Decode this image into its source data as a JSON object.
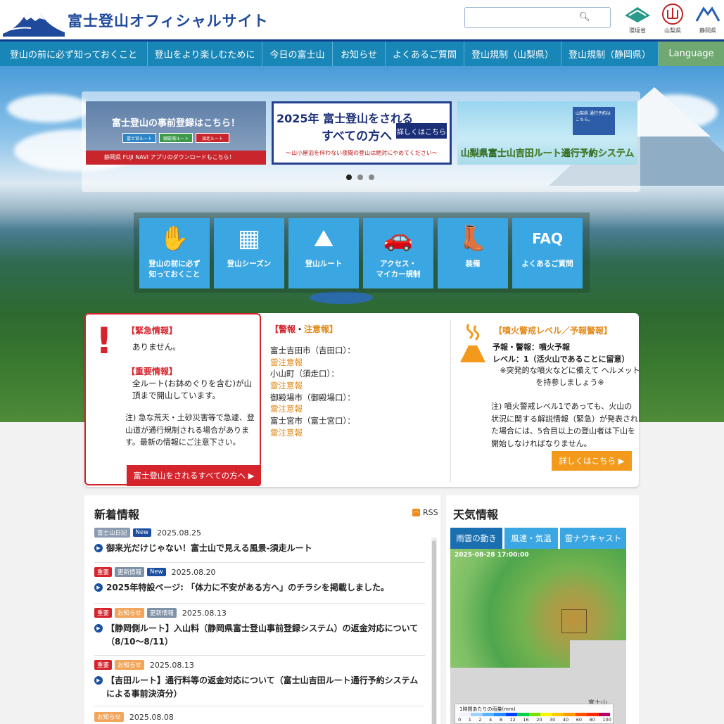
{
  "header": {
    "site_title": "富士登山オフィシャルサイト",
    "search_placeholder": "",
    "gov_logos": [
      {
        "name": "環境省",
        "icon": "env-ministry-logo"
      },
      {
        "name": "山梨県",
        "icon": "yamanashi-logo"
      },
      {
        "name": "静岡県",
        "icon": "shizuoka-logo"
      }
    ]
  },
  "nav": {
    "items": [
      {
        "label": "登山の前に必ず知っておくこと"
      },
      {
        "label": "登山をより楽しむために"
      },
      {
        "label": "今日の富士山"
      },
      {
        "label": "お知らせ"
      },
      {
        "label": "よくあるご質問"
      },
      {
        "label": "登山規制（山梨県）"
      },
      {
        "label": "登山規制（静岡県）"
      }
    ],
    "language": "Language"
  },
  "banners": {
    "b1": {
      "title": "富士登山の事前登録はこちら！",
      "routes": [
        "富士宮ルート",
        "御殿場ルート",
        "須走ルート"
      ],
      "footer": "静岡県 FUJI NAVI アプリのダウンロードもこちら！"
    },
    "b2": {
      "line1": "2025年 富士登山をされる",
      "line2": "すべての方へ",
      "button": "詳しくはこちら",
      "note": "～山小屋泊を伴わない夜間の登山は絶対にやめてください～"
    },
    "b3": {
      "box": "山梨県 通行予約はこちら。",
      "title": "山梨県富士山吉田ルート通行予約システム"
    }
  },
  "tiles": [
    {
      "label": "登山の前に必ず\n知っておくこと",
      "icon": "hand-icon",
      "glyph": "✋"
    },
    {
      "label": "登山シーズン",
      "icon": "calendar-icon",
      "glyph": "▦"
    },
    {
      "label": "登山ルート",
      "icon": "hiker-icon",
      "glyph": "⛰"
    },
    {
      "label": "アクセス・\nマイカー規制",
      "icon": "car-icon",
      "glyph": "🚗"
    },
    {
      "label": "装備",
      "icon": "hat-boot-icon",
      "glyph": "👢"
    },
    {
      "label": "よくあるご質問",
      "icon": "faq-icon",
      "glyph": "FAQ"
    }
  ],
  "emergency": {
    "heading1": "【緊急情報】",
    "text1": "ありません。",
    "heading2": "【重要情報】",
    "text2": "全ルート(お鉢めぐりを含む)が山頂まで開山しています。",
    "note": "注) 急な荒天・土砂災害等で急遽、登山道が通行規制される場合があります。最新の情報にご注意下さい。",
    "button": "富士登山をされるすべての方へ ▶"
  },
  "warnings": {
    "heading_a": "【警報",
    "sep": "・",
    "heading_b": "注意報】",
    "items": [
      {
        "place": "富士吉田市（吉田口）：",
        "level": "雷注意報"
      },
      {
        "place": "小山町（須走口）：",
        "level": "雷注意報"
      },
      {
        "place": "御殿場市（御殿場口）：",
        "level": "雷注意報"
      },
      {
        "place": "富士宮市（富士宮口）：",
        "level": "雷注意報"
      }
    ]
  },
  "volcano": {
    "heading": "【噴火警戒レベル／予報警報】",
    "line1": "予報・警報：噴火予報",
    "line2": "レベル：1（活火山であることに留意）",
    "line3": "※突発的な噴火などに備えて ヘルメットを持参しましょう※",
    "note": "注) 噴火警戒レベル1であっても、火山の状況に関する解説情報（緊急）が発表された場合には、5合目以上の登山者は下山を開始しなければなりません。",
    "button": "詳しくはこちら ▶"
  },
  "news": {
    "title": "新着情報",
    "rss": "RSS",
    "items": [
      {
        "tags": [
          {
            "text": "富士山日記",
            "color": "gray"
          },
          {
            "text": "New",
            "color": "blue"
          }
        ],
        "date": "2025.08.25",
        "headline": "御来光だけじゃない！富士山で見える風景-須走ルート"
      },
      {
        "tags": [
          {
            "text": "重要",
            "color": "red"
          },
          {
            "text": "更新情報",
            "color": "slate"
          },
          {
            "text": "New",
            "color": "blue"
          }
        ],
        "date": "2025.08.20",
        "headline": "2025年特設ページ: 「体力に不安がある方へ」のチラシを掲載しました。"
      },
      {
        "tags": [
          {
            "text": "重要",
            "color": "red"
          },
          {
            "text": "お知らせ",
            "color": "orange"
          },
          {
            "text": "更新情報",
            "color": "slate"
          }
        ],
        "date": "2025.08.13",
        "headline": "【静岡側ルート】入山料（静岡県富士登山事前登録システム）の返金対応について（8/10～8/11）"
      },
      {
        "tags": [
          {
            "text": "重要",
            "color": "red"
          },
          {
            "text": "お知らせ",
            "color": "orange"
          }
        ],
        "date": "2025.08.13",
        "headline": "【吉田ルート】通行料等の返金対応について（富士山吉田ルート通行予約システムによる事前決済分）"
      },
      {
        "tags": [
          {
            "text": "お知らせ",
            "color": "orange"
          }
        ],
        "date": "2025.08.08",
        "headline": ""
      }
    ]
  },
  "weather": {
    "title": "天気情報",
    "tabs": [
      "雨雲の動き",
      "風速・気温",
      "雷ナウキャスト"
    ],
    "timestamp": "2025-08-28 17:00:00",
    "fuji_label": "富士山",
    "legend_title": "1時間あたりの雨量(mm)",
    "legend_values": [
      "0",
      "1",
      "2",
      "4",
      "8",
      "12",
      "16",
      "20",
      "30",
      "40",
      "60",
      "80",
      "100"
    ],
    "legend_colors": [
      "#f2f2ff",
      "#a0d2ff",
      "#5ab4ff",
      "#218cff",
      "#0041ff",
      "#00d24a",
      "#7ae000",
      "#faf500",
      "#ffc800",
      "#ff9900",
      "#ff5000",
      "#ff2800",
      "#b4006a"
    ]
  }
}
